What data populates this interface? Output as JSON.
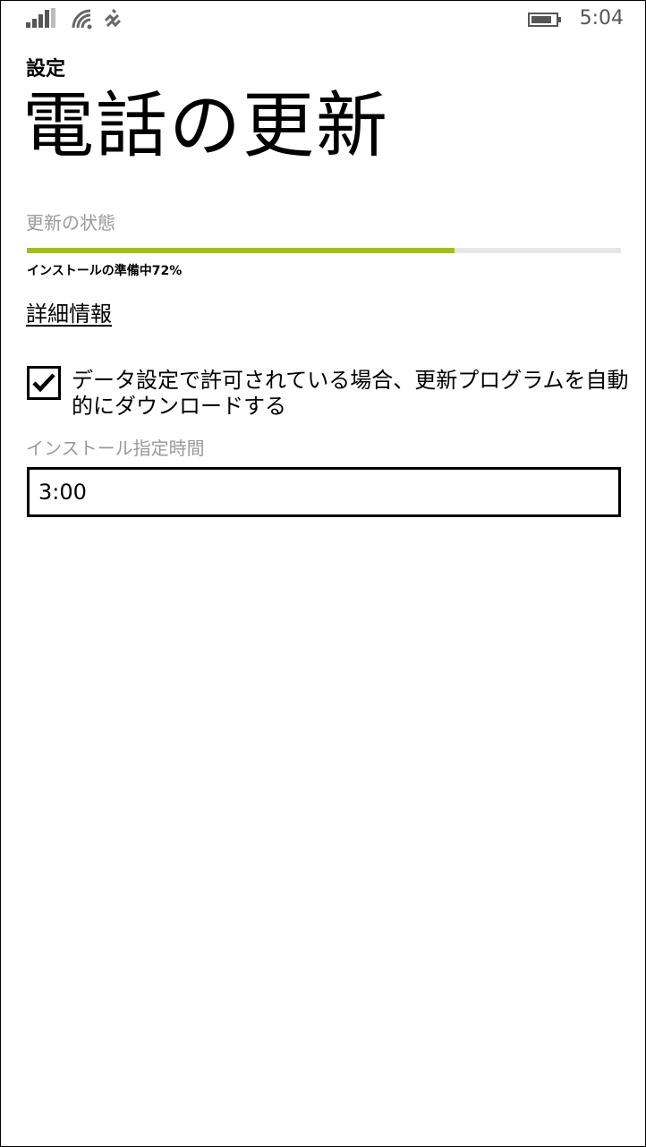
{
  "status_bar": {
    "time": "5:04",
    "icons": [
      "signal-icon",
      "wifi-icon",
      "vibrate-icon",
      "battery-icon"
    ]
  },
  "header": {
    "app_title": "設定",
    "page_title": "電話の更新"
  },
  "update_status": {
    "label": "更新の状態",
    "progress_text": "インストールの準備中72%",
    "progress_percent": 72,
    "accent_color": "#a2c013"
  },
  "details_link": "詳細情報",
  "auto_download": {
    "checked": true,
    "label": "データ設定で許可されている場合、更新プログラムを自動的にダウンロードする"
  },
  "install_time": {
    "label": "インストール指定時間",
    "value": "3:00"
  }
}
